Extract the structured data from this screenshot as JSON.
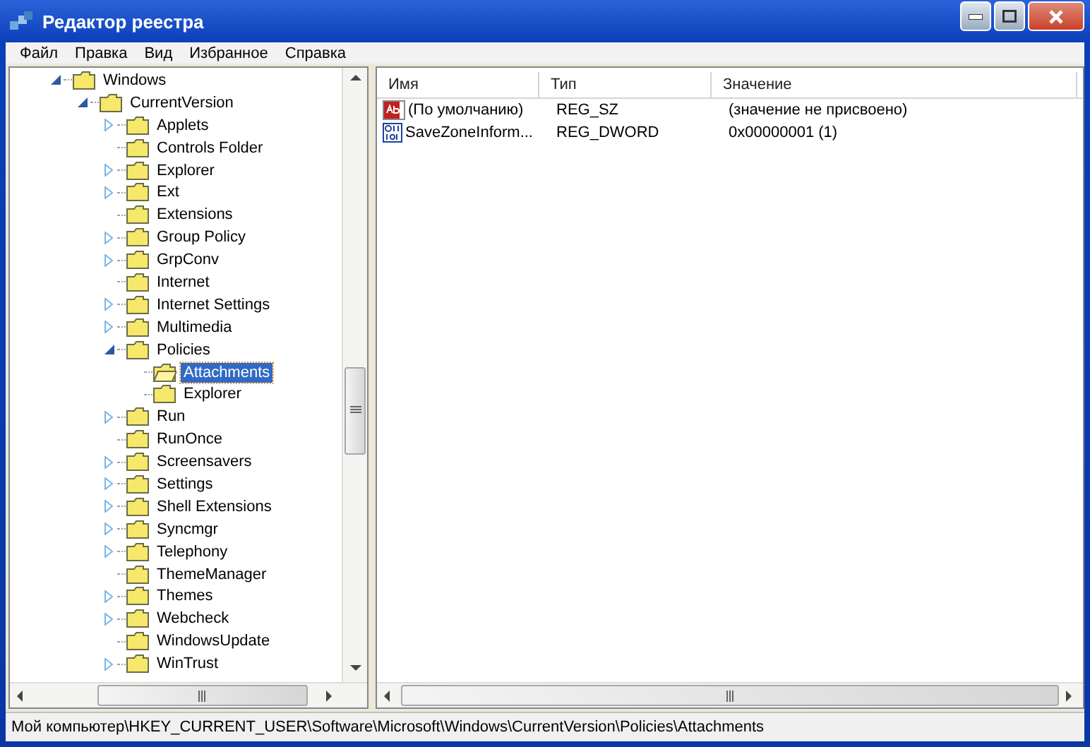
{
  "window": {
    "title": "Редактор реестра"
  },
  "menu": [
    "Файл",
    "Правка",
    "Вид",
    "Избранное",
    "Справка"
  ],
  "tree": [
    {
      "label": "Windows",
      "expanded": true,
      "selected": false,
      "children": [
        {
          "label": "CurrentVersion",
          "expanded": true,
          "selected": false,
          "children": [
            {
              "label": "Applets",
              "expanded": false,
              "selected": false
            },
            {
              "label": "Controls Folder",
              "selected": false
            },
            {
              "label": "Explorer",
              "expanded": false,
              "selected": false
            },
            {
              "label": "Ext",
              "expanded": false,
              "selected": false
            },
            {
              "label": "Extensions",
              "selected": false
            },
            {
              "label": "Group Policy",
              "expanded": false,
              "selected": false
            },
            {
              "label": "GrpConv",
              "expanded": false,
              "selected": false
            },
            {
              "label": "Internet",
              "selected": false
            },
            {
              "label": "Internet Settings",
              "expanded": false,
              "selected": false
            },
            {
              "label": "Multimedia",
              "expanded": false,
              "selected": false
            },
            {
              "label": "Policies",
              "expanded": true,
              "selected": false,
              "children": [
                {
                  "label": "Attachments",
                  "selected": true
                },
                {
                  "label": "Explorer",
                  "selected": false
                }
              ]
            },
            {
              "label": "Run",
              "expanded": false,
              "selected": false
            },
            {
              "label": "RunOnce",
              "selected": false
            },
            {
              "label": "Screensavers",
              "expanded": false,
              "selected": false
            },
            {
              "label": "Settings",
              "expanded": false,
              "selected": false
            },
            {
              "label": "Shell Extensions",
              "expanded": false,
              "selected": false
            },
            {
              "label": "Syncmgr",
              "expanded": false,
              "selected": false
            },
            {
              "label": "Telephony",
              "expanded": false,
              "selected": false
            },
            {
              "label": "ThemeManager",
              "selected": false
            },
            {
              "label": "Themes",
              "expanded": false,
              "selected": false
            },
            {
              "label": "Webcheck",
              "expanded": false,
              "selected": false
            },
            {
              "label": "WindowsUpdate",
              "selected": false
            },
            {
              "label": "WinTrust",
              "expanded": false,
              "selected": false
            }
          ]
        }
      ]
    }
  ],
  "table": {
    "columns": [
      "Имя",
      "Тип",
      "Значение"
    ],
    "rows": [
      {
        "kind": "string",
        "name": "(По умолчанию)",
        "type": "REG_SZ",
        "value": "(значение не присвоено)"
      },
      {
        "kind": "binary",
        "name": "SaveZoneInform...",
        "type": "REG_DWORD",
        "value": "0x00000001 (1)"
      }
    ]
  },
  "status_bar": "Мой компьютер\\HKEY_CURRENT_USER\\Software\\Microsoft\\Windows\\CurrentVersion\\Policies\\Attachments"
}
